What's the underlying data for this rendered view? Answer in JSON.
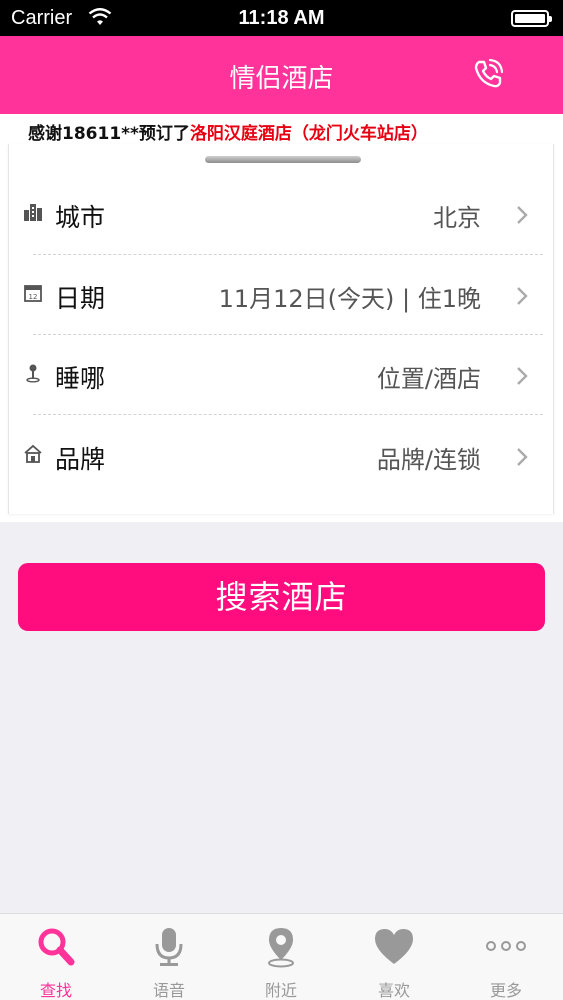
{
  "status_bar": {
    "carrier": "Carrier",
    "time": "11:18 AM"
  },
  "nav": {
    "title": "情侣酒店",
    "phone_icon": "phone-icon"
  },
  "ticker": {
    "prefix": "感谢18611**预订了",
    "highlight": "洛阳汉庭酒店（龙门火车站店）"
  },
  "form": {
    "rows": [
      {
        "label": "城市",
        "value": "北京",
        "icon": "city-buildings-icon"
      },
      {
        "label": "日期",
        "value": "11月12日(今天) | 住1晚",
        "icon": "calendar-icon"
      },
      {
        "label": "睡哪",
        "value": "位置/酒店",
        "icon": "location-pin-icon"
      },
      {
        "label": "品牌",
        "value": "品牌/连锁",
        "icon": "house-icon"
      }
    ]
  },
  "search_button": {
    "label": "搜索酒店"
  },
  "tabs": [
    {
      "label": "查找",
      "icon": "search-icon",
      "active": true
    },
    {
      "label": "语音",
      "icon": "microphone-icon",
      "active": false
    },
    {
      "label": "附近",
      "icon": "location-pin-icon",
      "active": false
    },
    {
      "label": "喜欢",
      "icon": "heart-icon",
      "active": false
    },
    {
      "label": "更多",
      "icon": "more-dots-icon",
      "active": false
    }
  ],
  "colors": {
    "brand": "#ff3399",
    "button": "#ff0c7f",
    "ticker_highlight": "#e60012",
    "tab_inactive": "#999999"
  }
}
